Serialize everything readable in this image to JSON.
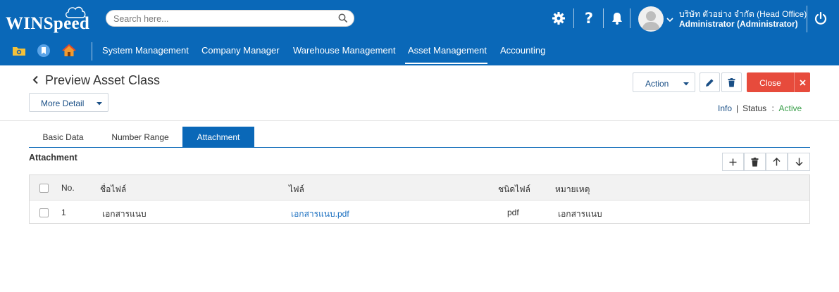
{
  "app": {
    "logo_text": "WINSpeed"
  },
  "search": {
    "placeholder": "Search here..."
  },
  "user": {
    "company": "บริษัท ตัวอย่าง จำกัด (Head Office)",
    "role": "Administrator (Administrator)"
  },
  "menu": {
    "items": [
      {
        "label": "System Management"
      },
      {
        "label": "Company Manager"
      },
      {
        "label": "Warehouse Management"
      },
      {
        "label": "Asset Management"
      },
      {
        "label": "Accounting"
      }
    ],
    "active": "Asset Management"
  },
  "page": {
    "title": "Preview Asset Class",
    "more_detail_label": "More Detail",
    "action_label": "Action",
    "close_label": "Close",
    "info_label": "Info",
    "status_label": "Status",
    "status_separator": ":",
    "status_value": "Active"
  },
  "tabs": [
    {
      "label": "Basic Data"
    },
    {
      "label": "Number Range"
    },
    {
      "label": "Attachment"
    }
  ],
  "active_tab": "Attachment",
  "attachment": {
    "section_title": "Attachment",
    "columns": [
      "No.",
      "ชื่อไฟล์",
      "ไฟล์",
      "ชนิดไฟล์",
      "หมายเหตุ"
    ],
    "rows": [
      {
        "no": "1",
        "name": "เอกสารแนบ",
        "file": "เอกสารแนบ.pdf",
        "type": "pdf",
        "note": "เอกสารแนบ"
      }
    ]
  },
  "colors": {
    "primary": "#0a68b8",
    "close": "#e74b3c",
    "status_active": "#3a9f4a",
    "link": "#1a6fc0"
  }
}
